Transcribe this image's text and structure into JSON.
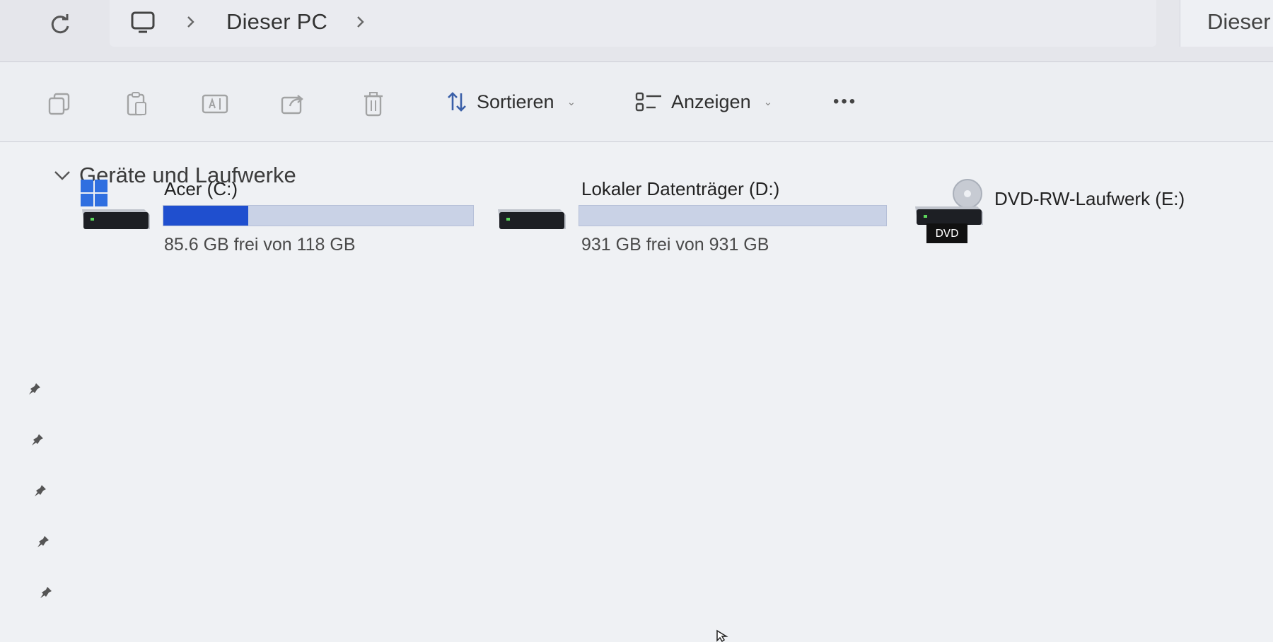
{
  "addressbar": {
    "refresh_icon": "refresh-icon",
    "pc_icon": "monitor-icon",
    "breadcrumb": [
      "Dieser PC"
    ],
    "search_text": "Dieser"
  },
  "toolbar": {
    "copy_icon": "copy-icon",
    "paste_icon": "paste-icon",
    "rename_icon": "rename-icon",
    "share_icon": "share-icon",
    "delete_icon": "delete-icon",
    "sort_label": "Sortieren",
    "view_label": "Anzeigen",
    "more_label": "•••"
  },
  "main": {
    "group_title": "Geräte und Laufwerke",
    "drives": [
      {
        "name": "Acer (C:)",
        "free_text": "85.6 GB frei von 118 GB",
        "used_fraction": 0.275,
        "icon": "windows-drive-icon"
      },
      {
        "name": "Lokaler Datenträger (D:)",
        "free_text": "931 GB frei von 931 GB",
        "used_fraction": 0.0,
        "icon": "hard-drive-icon"
      },
      {
        "name": "DVD-RW-Laufwerk (E:)",
        "badge": "DVD",
        "icon": "dvd-drive-icon"
      }
    ]
  },
  "colors": {
    "accent": "#1f4fcf",
    "bar_track": "#c9d2e6",
    "background": "#eff1f4"
  }
}
